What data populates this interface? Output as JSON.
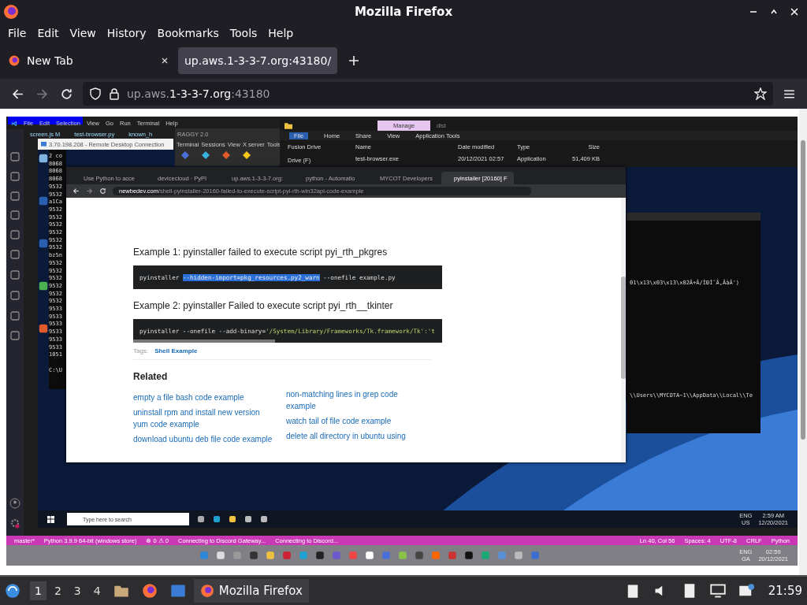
{
  "window": {
    "title": "Mozilla Firefox"
  },
  "menu": [
    "File",
    "Edit",
    "View",
    "History",
    "Bookmarks",
    "Tools",
    "Help"
  ],
  "tabs": [
    {
      "label": "New Tab",
      "selected": false
    },
    {
      "label": "up.aws.1-3-3-7.org:43180/",
      "selected": true
    }
  ],
  "address": {
    "prefix": "up.aws.",
    "domain": "1-3-3-7.org",
    "suffix": ":43180"
  },
  "remote": {
    "vscode_menu": [
      "File",
      "Edit",
      "Selection",
      "View",
      "Go",
      "Run",
      "Terminal",
      "Help"
    ],
    "editor_tabs": [
      "screen.js M",
      "test-browser.py",
      "known_h"
    ],
    "rdp_title": "3.70.198.208 - Remote Desktop Connection",
    "raggy": {
      "title": "RAGGY 2.0",
      "menu": [
        "Terminal",
        "Sessions",
        "View",
        "X server",
        "Tools"
      ]
    },
    "explorer": {
      "manage": "Manage",
      "folder": "dist",
      "ribbon": [
        {
          "label": "File",
          "selected": true
        },
        {
          "label": "Home",
          "selected": false
        },
        {
          "label": "Share",
          "selected": false
        },
        {
          "label": "View",
          "selected": false
        },
        {
          "label": "Application Tools",
          "selected": false
        }
      ],
      "nav": [
        "Fusion Drive",
        "Drive (F)"
      ],
      "columns": [
        "Name",
        "Date modified",
        "Type",
        "Size"
      ],
      "row": [
        "test-browser.exe",
        "20/12/2021 02:57",
        "Application",
        "51,409 KB"
      ]
    },
    "console_lines": [
      "2 co",
      "8068",
      "8068",
      "8068",
      "9532",
      "9532",
      "a1Ca",
      "9532",
      "9532",
      "9532",
      "9532",
      "9532",
      "9532",
      "bz5n",
      "9532",
      "9532",
      "9532",
      "9532",
      "9532",
      "9532",
      "9533",
      "9533",
      "9533",
      "9533",
      "9533",
      "9533",
      "1051"
    ],
    "console_prompt": "C:\\U",
    "terminal_lines": [
      "01\\x13\\x03\\x13\\x02Â+Â/ÌÐÌ¯Â,ÂàÂ')",
      "\\\\Users\\\\MYCOTA~1\\\\AppData\\\\Local\\\\Te"
    ],
    "chrome": {
      "tabs": [
        {
          "label": "Use Python to acce",
          "selected": false
        },
        {
          "label": "devicecloud · PyPI",
          "selected": false
        },
        {
          "label": "up.aws.1-3-3-7.org:",
          "selected": false
        },
        {
          "label": "python - Automatio",
          "selected": false
        },
        {
          "label": "MYCOT Developers",
          "selected": false
        },
        {
          "label": "pyinstaller [20160] F",
          "selected": true
        }
      ],
      "url_host": "newbedev.com",
      "url_path": "/shell-pyinstaller-20160-failed-to-execute-script-pyi-rth-win32api-code-example",
      "examples": [
        {
          "title": "Example 1: pyinstaller failed to execute script pyi_rth_pkgres",
          "code": [
            {
              "text": "pyinstaller ",
              "kind": "plain"
            },
            {
              "text": "--hidden-import=pkg_resources.py2_warn",
              "kind": "highlight"
            },
            {
              "text": " --onefile example.py",
              "kind": "plain"
            }
          ]
        },
        {
          "title": "Example 2: pyinstaller Failed to execute script pyi_rth__tkinter",
          "code": [
            {
              "text": "pyinstaller --onefile --add-binary=",
              "kind": "plain"
            },
            {
              "text": "'/System/Library/Frameworks/Tk.framework/Tk':'t",
              "kind": "string"
            }
          ]
        }
      ],
      "tags_label": "Tags:",
      "tag": "Shell Example",
      "related_title": "Related",
      "related": [
        [
          "empty a file bash code example",
          "uninstall rpm and install new version yum code example",
          "download ubuntu deb file code example"
        ],
        [
          "non-matching lines in grep code example",
          "watch tail of file code example",
          "delete all directory in ubuntu using"
        ]
      ]
    },
    "win_search": "Type here to search",
    "win_tray": [
      "ENG",
      "2:59 AM",
      "US",
      "12/20/2021"
    ],
    "status_left": [
      "master*",
      "Python 3.9.9 64-bit (windows store)",
      "⊗ 0 ⚠ 0",
      "Connecting to Discord Gateway...",
      "Connecting to Discord..."
    ],
    "status_right": [
      "Ln 40, Col 56",
      "Spaces: 4",
      "UTF-8",
      "CRLF",
      "Python"
    ],
    "win11_tray": [
      "ENG",
      "02:59",
      "GA",
      "20/12/2021"
    ]
  },
  "panel": {
    "workspaces": [
      {
        "label": "1",
        "selected": true
      },
      {
        "label": "2",
        "selected": false
      },
      {
        "label": "3",
        "selected": false
      },
      {
        "label": "4",
        "selected": false
      }
    ],
    "task": "Mozilla Firefox",
    "clock": "21:59"
  }
}
